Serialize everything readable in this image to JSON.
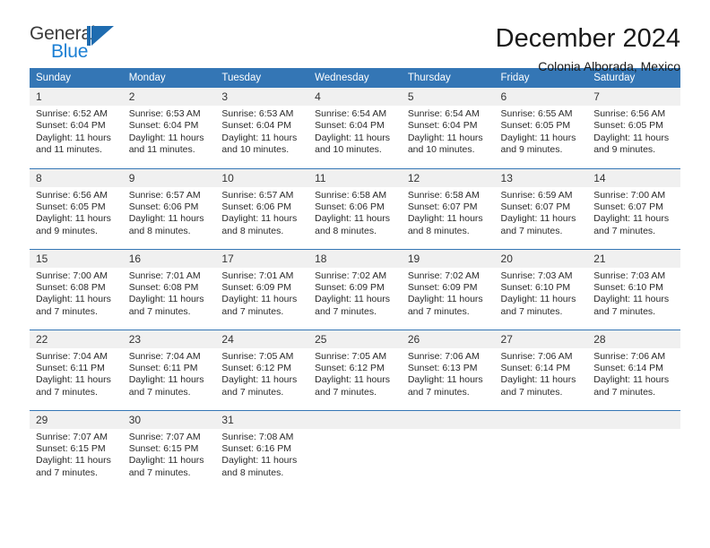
{
  "brand": {
    "name_part1": "General",
    "name_part2": "Blue",
    "mark": "triangle-logo"
  },
  "header": {
    "title": "December 2024",
    "subtitle": "Colonia Alborada, Mexico"
  },
  "calendar": {
    "weekday_headers": [
      "Sunday",
      "Monday",
      "Tuesday",
      "Wednesday",
      "Thursday",
      "Friday",
      "Saturday"
    ],
    "colors": {
      "header_blue": "#3476b5",
      "daynum_band": "#f0f0f0",
      "brand_blue": "#1b7fd4",
      "text": "#2a2a2a"
    },
    "weeks": [
      [
        {
          "day": "1",
          "sunrise": "Sunrise: 6:52 AM",
          "sunset": "Sunset: 6:04 PM",
          "daylight": "Daylight: 11 hours and 11 minutes."
        },
        {
          "day": "2",
          "sunrise": "Sunrise: 6:53 AM",
          "sunset": "Sunset: 6:04 PM",
          "daylight": "Daylight: 11 hours and 11 minutes."
        },
        {
          "day": "3",
          "sunrise": "Sunrise: 6:53 AM",
          "sunset": "Sunset: 6:04 PM",
          "daylight": "Daylight: 11 hours and 10 minutes."
        },
        {
          "day": "4",
          "sunrise": "Sunrise: 6:54 AM",
          "sunset": "Sunset: 6:04 PM",
          "daylight": "Daylight: 11 hours and 10 minutes."
        },
        {
          "day": "5",
          "sunrise": "Sunrise: 6:54 AM",
          "sunset": "Sunset: 6:04 PM",
          "daylight": "Daylight: 11 hours and 10 minutes."
        },
        {
          "day": "6",
          "sunrise": "Sunrise: 6:55 AM",
          "sunset": "Sunset: 6:05 PM",
          "daylight": "Daylight: 11 hours and 9 minutes."
        },
        {
          "day": "7",
          "sunrise": "Sunrise: 6:56 AM",
          "sunset": "Sunset: 6:05 PM",
          "daylight": "Daylight: 11 hours and 9 minutes."
        }
      ],
      [
        {
          "day": "8",
          "sunrise": "Sunrise: 6:56 AM",
          "sunset": "Sunset: 6:05 PM",
          "daylight": "Daylight: 11 hours and 9 minutes."
        },
        {
          "day": "9",
          "sunrise": "Sunrise: 6:57 AM",
          "sunset": "Sunset: 6:06 PM",
          "daylight": "Daylight: 11 hours and 8 minutes."
        },
        {
          "day": "10",
          "sunrise": "Sunrise: 6:57 AM",
          "sunset": "Sunset: 6:06 PM",
          "daylight": "Daylight: 11 hours and 8 minutes."
        },
        {
          "day": "11",
          "sunrise": "Sunrise: 6:58 AM",
          "sunset": "Sunset: 6:06 PM",
          "daylight": "Daylight: 11 hours and 8 minutes."
        },
        {
          "day": "12",
          "sunrise": "Sunrise: 6:58 AM",
          "sunset": "Sunset: 6:07 PM",
          "daylight": "Daylight: 11 hours and 8 minutes."
        },
        {
          "day": "13",
          "sunrise": "Sunrise: 6:59 AM",
          "sunset": "Sunset: 6:07 PM",
          "daylight": "Daylight: 11 hours and 7 minutes."
        },
        {
          "day": "14",
          "sunrise": "Sunrise: 7:00 AM",
          "sunset": "Sunset: 6:07 PM",
          "daylight": "Daylight: 11 hours and 7 minutes."
        }
      ],
      [
        {
          "day": "15",
          "sunrise": "Sunrise: 7:00 AM",
          "sunset": "Sunset: 6:08 PM",
          "daylight": "Daylight: 11 hours and 7 minutes."
        },
        {
          "day": "16",
          "sunrise": "Sunrise: 7:01 AM",
          "sunset": "Sunset: 6:08 PM",
          "daylight": "Daylight: 11 hours and 7 minutes."
        },
        {
          "day": "17",
          "sunrise": "Sunrise: 7:01 AM",
          "sunset": "Sunset: 6:09 PM",
          "daylight": "Daylight: 11 hours and 7 minutes."
        },
        {
          "day": "18",
          "sunrise": "Sunrise: 7:02 AM",
          "sunset": "Sunset: 6:09 PM",
          "daylight": "Daylight: 11 hours and 7 minutes."
        },
        {
          "day": "19",
          "sunrise": "Sunrise: 7:02 AM",
          "sunset": "Sunset: 6:09 PM",
          "daylight": "Daylight: 11 hours and 7 minutes."
        },
        {
          "day": "20",
          "sunrise": "Sunrise: 7:03 AM",
          "sunset": "Sunset: 6:10 PM",
          "daylight": "Daylight: 11 hours and 7 minutes."
        },
        {
          "day": "21",
          "sunrise": "Sunrise: 7:03 AM",
          "sunset": "Sunset: 6:10 PM",
          "daylight": "Daylight: 11 hours and 7 minutes."
        }
      ],
      [
        {
          "day": "22",
          "sunrise": "Sunrise: 7:04 AM",
          "sunset": "Sunset: 6:11 PM",
          "daylight": "Daylight: 11 hours and 7 minutes."
        },
        {
          "day": "23",
          "sunrise": "Sunrise: 7:04 AM",
          "sunset": "Sunset: 6:11 PM",
          "daylight": "Daylight: 11 hours and 7 minutes."
        },
        {
          "day": "24",
          "sunrise": "Sunrise: 7:05 AM",
          "sunset": "Sunset: 6:12 PM",
          "daylight": "Daylight: 11 hours and 7 minutes."
        },
        {
          "day": "25",
          "sunrise": "Sunrise: 7:05 AM",
          "sunset": "Sunset: 6:12 PM",
          "daylight": "Daylight: 11 hours and 7 minutes."
        },
        {
          "day": "26",
          "sunrise": "Sunrise: 7:06 AM",
          "sunset": "Sunset: 6:13 PM",
          "daylight": "Daylight: 11 hours and 7 minutes."
        },
        {
          "day": "27",
          "sunrise": "Sunrise: 7:06 AM",
          "sunset": "Sunset: 6:14 PM",
          "daylight": "Daylight: 11 hours and 7 minutes."
        },
        {
          "day": "28",
          "sunrise": "Sunrise: 7:06 AM",
          "sunset": "Sunset: 6:14 PM",
          "daylight": "Daylight: 11 hours and 7 minutes."
        }
      ],
      [
        {
          "day": "29",
          "sunrise": "Sunrise: 7:07 AM",
          "sunset": "Sunset: 6:15 PM",
          "daylight": "Daylight: 11 hours and 7 minutes."
        },
        {
          "day": "30",
          "sunrise": "Sunrise: 7:07 AM",
          "sunset": "Sunset: 6:15 PM",
          "daylight": "Daylight: 11 hours and 7 minutes."
        },
        {
          "day": "31",
          "sunrise": "Sunrise: 7:08 AM",
          "sunset": "Sunset: 6:16 PM",
          "daylight": "Daylight: 11 hours and 8 minutes."
        },
        {
          "day": "",
          "sunrise": "",
          "sunset": "",
          "daylight": ""
        },
        {
          "day": "",
          "sunrise": "",
          "sunset": "",
          "daylight": ""
        },
        {
          "day": "",
          "sunrise": "",
          "sunset": "",
          "daylight": ""
        },
        {
          "day": "",
          "sunrise": "",
          "sunset": "",
          "daylight": ""
        }
      ]
    ]
  }
}
